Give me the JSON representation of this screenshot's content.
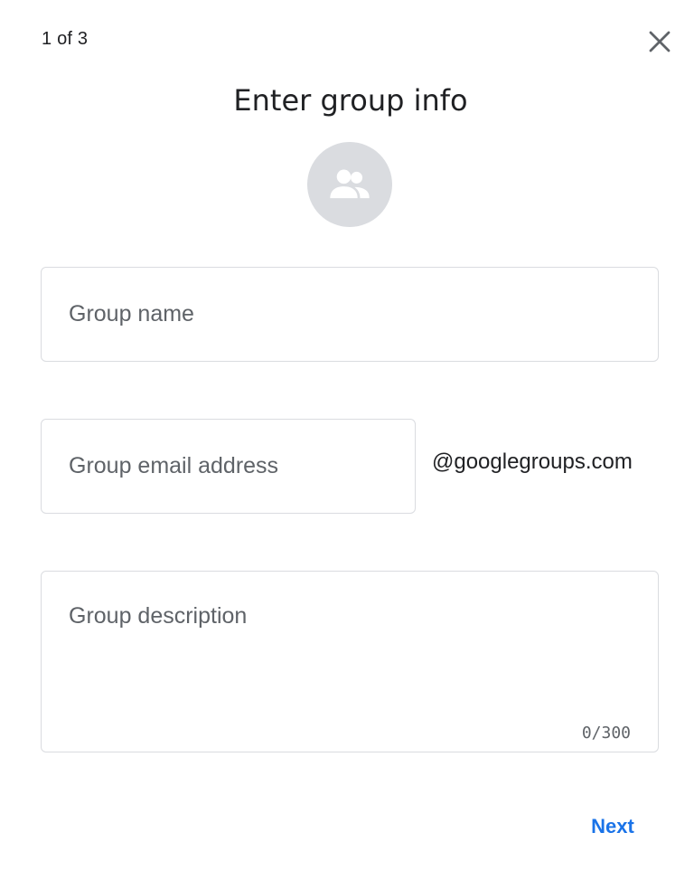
{
  "dialog": {
    "step_indicator": "1 of 3",
    "title": "Enter group info",
    "close_icon": "close-icon",
    "avatar_icon": "group-icon"
  },
  "form": {
    "group_name": {
      "value": "",
      "placeholder": "Group name"
    },
    "group_email": {
      "value": "",
      "placeholder": "Group email address",
      "suffix": "@googlegroups.com"
    },
    "group_description": {
      "value": "",
      "placeholder": "Group description",
      "counter": "0/300"
    }
  },
  "actions": {
    "next_label": "Next"
  },
  "colors": {
    "accent": "#1a73e8",
    "avatar_bg": "#dadce0",
    "border": "#dadce0",
    "placeholder": "#5f6368"
  }
}
